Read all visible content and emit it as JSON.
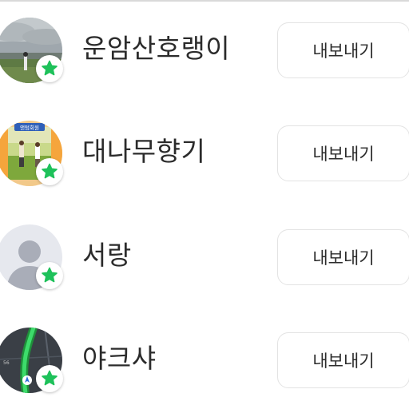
{
  "members": [
    {
      "name": "운암산호랭이",
      "avatar_icon": "landscape-photo-avatar",
      "badge_icon": "star-icon",
      "action_label": "내보내기"
    },
    {
      "name": "대나무향기",
      "avatar_icon": "golf-photo-avatar",
      "badge_icon": "star-icon",
      "action_label": "내보내기"
    },
    {
      "name": "서랑",
      "avatar_icon": "default-person-avatar",
      "badge_icon": "star-icon",
      "action_label": "내보내기"
    },
    {
      "name": "야크샤",
      "avatar_icon": "map-navigation-avatar",
      "badge_icon": "star-icon",
      "action_label": "내보내기"
    }
  ],
  "avatar_texts": {
    "golf_banner": "앤텀회원",
    "map_marker": "56"
  },
  "colors": {
    "badge_star": "#1ec15a",
    "button_border": "#e3e3e3",
    "name_text": "#2b2b2b",
    "top_border": "#d9d9d9"
  }
}
